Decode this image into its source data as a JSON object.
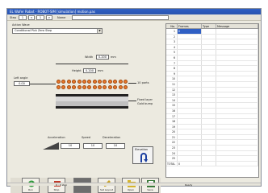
{
  "window": {
    "title": "EL Wafer Robot - ROBOT-SIM [simulation] motion.pas"
  },
  "toolbar": {
    "step_label": "Step",
    "step_value": "1",
    "of_value": "1",
    "name_label": "Name"
  },
  "left": {
    "group_label": "Action Wave",
    "mode_select": "Conditional Pick Zero Step",
    "width_label": "Width",
    "width_value": "0.200",
    "width_unit": "mm",
    "height_label": "Height",
    "height_value": "0.200",
    "height_unit": "mm",
    "left_angle_label": "Left angle",
    "left_angle_value": "0.00",
    "label_top": "10 parts",
    "label_bottom_1": "Fixed layer",
    "label_bottom_2": "Gold bump",
    "accel_label": "Acceleration",
    "accel_value": "10",
    "speed_label": "Speed",
    "speed_value": "10",
    "decel_label": "Deceleration",
    "decel_value": "10",
    "elevation_button": "Elevation"
  },
  "table": {
    "headers": [
      "No.",
      "Frames",
      "Type",
      "Message"
    ],
    "rows": [
      {
        "no": "1",
        "frames": "0"
      },
      {
        "no": "2",
        "frames": ""
      },
      {
        "no": "3",
        "frames": ""
      },
      {
        "no": "4",
        "frames": ""
      },
      {
        "no": "5",
        "frames": ""
      },
      {
        "no": "6",
        "frames": ""
      },
      {
        "no": "7",
        "frames": ""
      },
      {
        "no": "8",
        "frames": ""
      },
      {
        "no": "9",
        "frames": ""
      },
      {
        "no": "10",
        "frames": ""
      },
      {
        "no": "11",
        "frames": ""
      },
      {
        "no": "12",
        "frames": ""
      },
      {
        "no": "13",
        "frames": ""
      },
      {
        "no": "14",
        "frames": ""
      },
      {
        "no": "15",
        "frames": ""
      },
      {
        "no": "16",
        "frames": ""
      },
      {
        "no": "17",
        "frames": ""
      },
      {
        "no": "18",
        "frames": ""
      },
      {
        "no": "19",
        "frames": ""
      },
      {
        "no": "20",
        "frames": ""
      },
      {
        "no": "21",
        "frames": ""
      },
      {
        "no": "22",
        "frames": ""
      },
      {
        "no": "23",
        "frames": ""
      },
      {
        "no": "24",
        "frames": ""
      },
      {
        "no": "25",
        "frames": ""
      }
    ],
    "total_label": "TOTAL",
    "total_value": "0"
  },
  "bottom": {
    "buttons": [
      {
        "label": "Run",
        "icon": "run-icon",
        "color": "#2e9a3a"
      },
      {
        "label": "Stop",
        "icon": "stop-icon",
        "color": "#c23a2a"
      },
      {
        "label": "",
        "icon": "",
        "color": "#6d6d6d"
      },
      {
        "label": "Set Layout",
        "icon": "pencil-icon",
        "color": "#c9a324"
      },
      {
        "label": "Open",
        "icon": "folder-icon",
        "color": "#d6b52e"
      },
      {
        "label": "Save",
        "icon": "save-icon",
        "color": "#3a7a3a"
      }
    ]
  },
  "status": {
    "left": "0 : 0 step",
    "right": "Ready"
  },
  "colors": {
    "accent": "#2f5fc4",
    "bump": "#e8772c"
  }
}
